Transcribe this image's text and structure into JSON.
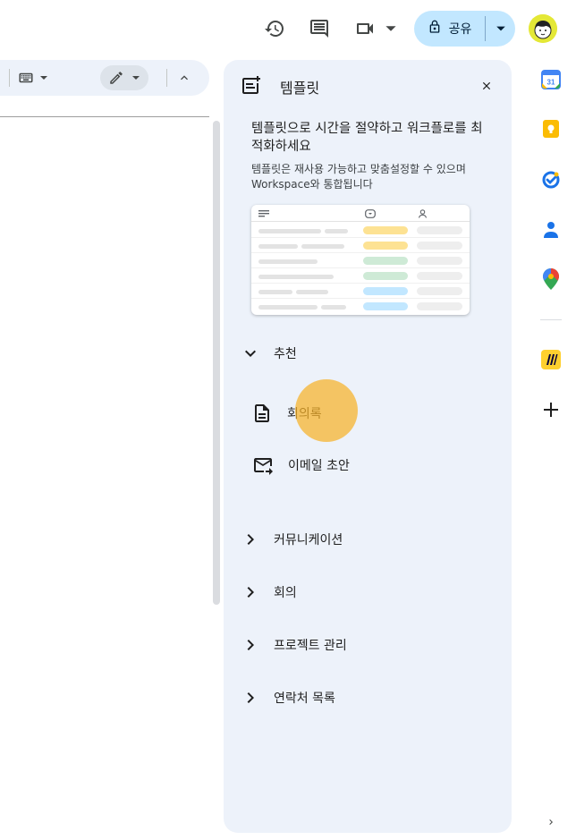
{
  "header": {
    "share_label": "공유",
    "icons": [
      "history-icon",
      "comment-icon",
      "video-icon",
      "lock-icon",
      "dropdown-icon",
      "avatar"
    ]
  },
  "toolbar": {
    "icons": [
      "keyboard-icon",
      "pencil-icon",
      "chevron-up-icon"
    ]
  },
  "panel": {
    "title": "템플릿",
    "headline": "템플릿으로 시간을 절약하고 워크플로를 최적화하세요",
    "subtext": "템플릿은 재사용 가능하고 맞춤설정할 수 있으며 Workspace와 통합됩니다",
    "preview_chip_colors": [
      "#fde293",
      "#fde293",
      "#ceead6",
      "#ceead6",
      "#c2e7ff",
      "#c2e7ff"
    ],
    "sections": {
      "recommended": {
        "label": "추천",
        "items": [
          {
            "label": "회의록",
            "icon": "document-icon"
          },
          {
            "label": "이메일 초안",
            "icon": "email-draft-icon"
          }
        ]
      },
      "others": [
        {
          "label": "커뮤니케이션"
        },
        {
          "label": "회의"
        },
        {
          "label": "프로젝트 관리"
        },
        {
          "label": "연락처 목록"
        }
      ]
    }
  },
  "rail": {
    "icons": [
      "calendar-icon",
      "keep-icon",
      "tasks-icon",
      "contacts-icon",
      "maps-icon",
      "miro-icon",
      "add-icon",
      "expand-icon"
    ],
    "calendar_day": "31"
  },
  "colors": {
    "panel_bg": "#edf2fa",
    "share_bg": "#c2e7ff",
    "accent_blue": "#1a73e8",
    "cursor_highlight": "#f7b228"
  }
}
